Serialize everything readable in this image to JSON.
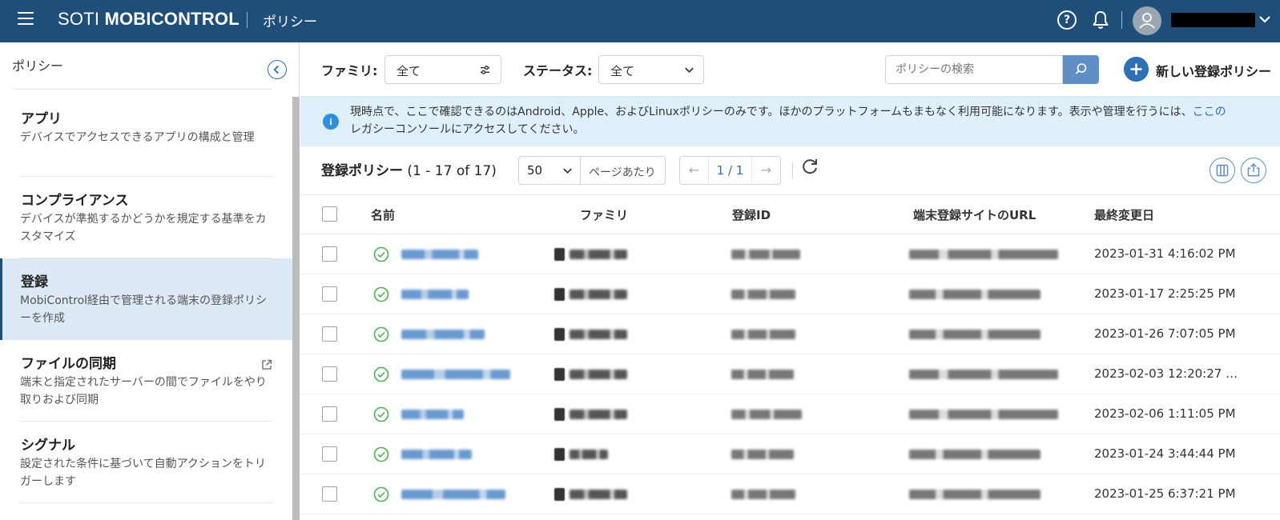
{
  "topbar": {
    "brand_light": "SOTI ",
    "brand_bold": "MOBICONTROL",
    "app_title": "ポリシー",
    "help_icon": "?"
  },
  "sidebar": {
    "header": "ポリシー",
    "items": [
      {
        "title": "アプリ",
        "desc": "デバイスでアクセスできるアプリの構成と管理"
      },
      {
        "title": "コンプライアンス",
        "desc": "デバイスが準拠するかどうかを規定する基準をカスタマイズ"
      },
      {
        "title": "登録",
        "desc": "MobiControl経由で管理される端末の登録ポリシーを作成",
        "active": true
      },
      {
        "title": "ファイルの同期",
        "desc": "端末と指定されたサーバーの間でファイルをやり取りおよび同期",
        "external": true
      },
      {
        "title": "シグナル",
        "desc": "設定された条件に基づいて自動アクションをトリガーします"
      }
    ]
  },
  "toolbar": {
    "family_label": "ファミリ:",
    "family_value": "全て",
    "status_label": "ステータス:",
    "status_value": "全て",
    "search_placeholder": "ポリシーの検索",
    "add_label": "新しい登録ポリシー"
  },
  "banner": {
    "text": "現時点で、ここで確認できるのはAndroid、Apple、およびLinuxポリシーのみです。ほかのプラットフォームもまもなく利用可能になります。表示や管理を行うには、",
    "link": "ここの",
    "text2": "レガシーコンソールにアクセスしてください。"
  },
  "list": {
    "title": "登録ポリシー",
    "range": "(1 - 17 of 17)",
    "per_page_value": "50",
    "per_page_label": "ページあたり",
    "page": "1 / 1"
  },
  "table": {
    "columns": [
      "名前",
      "ファミリ",
      "登録ID",
      "端末登録サイトのURL",
      "最終変更日"
    ],
    "rows": [
      {
        "date": "2023-01-31 4:16:02 PM"
      },
      {
        "date": "2023-01-17 2:25:25 PM"
      },
      {
        "date": "2023-01-26 7:07:05 PM"
      },
      {
        "date": "2023-02-03 12:20:27 …"
      },
      {
        "date": "2023-02-06 1:11:05 PM"
      },
      {
        "date": "2023-01-24 3:44:44 PM"
      },
      {
        "date": "2023-01-25 6:37:21 PM"
      }
    ]
  },
  "colors": {
    "topbar": "#1f4e79",
    "accent": "#2f6fb3",
    "banner_bg": "#dff0fa",
    "active_bg": "#dde9f4",
    "status_ok": "#4caf50"
  }
}
